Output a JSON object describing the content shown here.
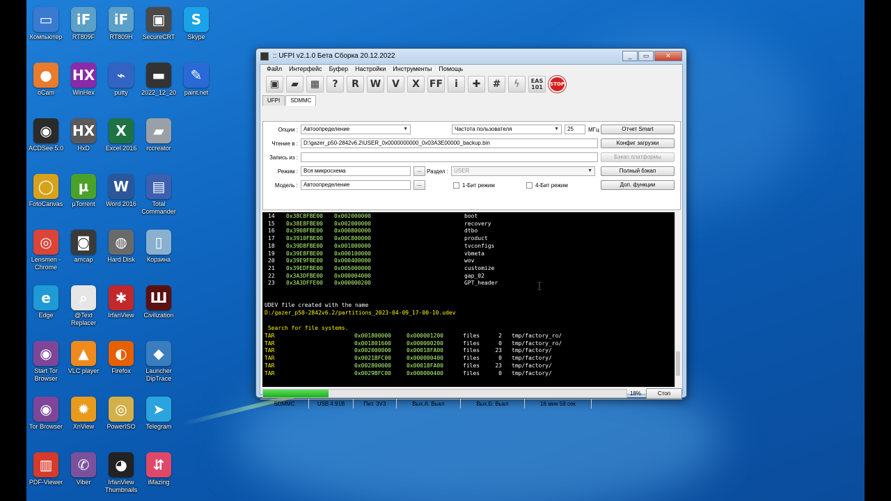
{
  "desktop": {
    "icons": [
      {
        "label": "Компьютер",
        "icon": "computer-icon",
        "glyph": "▭",
        "color": "#3a7ad0",
        "col": 0,
        "row": 0
      },
      {
        "label": "RT809F",
        "icon": "ifix-icon",
        "glyph": "iF",
        "color": "#5aa0c8",
        "col": 1,
        "row": 0
      },
      {
        "label": "RT809H",
        "icon": "ifix-icon",
        "glyph": "iF",
        "color": "#5aa0c8",
        "col": 2,
        "row": 0
      },
      {
        "label": "SecureCRT",
        "icon": "terminal-icon",
        "glyph": "▣",
        "color": "#4a4a4a",
        "col": 3,
        "row": 0
      },
      {
        "label": "Skype",
        "icon": "skype-icon",
        "glyph": "S",
        "color": "#1aa3e8",
        "col": 4,
        "row": 0
      },
      {
        "label": "oCam",
        "icon": "camera-icon",
        "glyph": "●",
        "color": "#e87b2c",
        "col": 0,
        "row": 1
      },
      {
        "label": "WinHex",
        "icon": "winhex-icon",
        "glyph": "HX",
        "color": "#8a2aa8",
        "col": 1,
        "row": 1
      },
      {
        "label": "putty",
        "icon": "putty-icon",
        "glyph": "⌁",
        "color": "#3364c4",
        "col": 2,
        "row": 1
      },
      {
        "label": "2022_12_20",
        "icon": "chip-icon",
        "glyph": "▬",
        "color": "#333333",
        "col": 3,
        "row": 1
      },
      {
        "label": "paint.net",
        "icon": "paint-icon",
        "glyph": "✎",
        "color": "#2a6ad6",
        "col": 4,
        "row": 1
      },
      {
        "label": "ACDSee 5.0",
        "icon": "eye-icon",
        "glyph": "◉",
        "color": "#2a2a2a",
        "col": 0,
        "row": 2
      },
      {
        "label": "HxD",
        "icon": "hxd-icon",
        "glyph": "HX",
        "color": "#5a5a5a",
        "col": 1,
        "row": 2
      },
      {
        "label": "Excel 2016",
        "icon": "excel-icon",
        "glyph": "X",
        "color": "#1f7244",
        "col": 2,
        "row": 2
      },
      {
        "label": "rccreator",
        "icon": "usb-icon",
        "glyph": "▰",
        "color": "#9aa0a8",
        "col": 3,
        "row": 2
      },
      {
        "label": "FotoCanvas",
        "icon": "fotocanvas-icon",
        "glyph": "◯",
        "color": "#d7a21a",
        "col": 0,
        "row": 3
      },
      {
        "label": "µTorrent",
        "icon": "utorrent-icon",
        "glyph": "µ",
        "color": "#4aa22a",
        "col": 1,
        "row": 3
      },
      {
        "label": "Word 2016",
        "icon": "word-icon",
        "glyph": "W",
        "color": "#2b579a",
        "col": 2,
        "row": 3
      },
      {
        "label": "Total Commander",
        "icon": "save-disk-icon",
        "glyph": "▤",
        "color": "#3c5fb0",
        "col": 3,
        "row": 3
      },
      {
        "label": "Lensmen - Chrome",
        "icon": "chrome-icon",
        "glyph": "◎",
        "color": "#db4437",
        "col": 0,
        "row": 4
      },
      {
        "label": "amcap",
        "icon": "camera-icon",
        "glyph": "◙",
        "color": "#3a3a3a",
        "col": 1,
        "row": 4
      },
      {
        "label": "Hard Disk",
        "icon": "harddisk-icon",
        "glyph": "◍",
        "color": "#6a6a6a",
        "col": 2,
        "row": 4
      },
      {
        "label": "Корзина",
        "icon": "trash-icon",
        "glyph": "▯",
        "color": "#8ab0d0",
        "col": 3,
        "row": 4
      },
      {
        "label": "Edge",
        "icon": "edge-icon",
        "glyph": "e",
        "color": "#1e9ad6",
        "col": 0,
        "row": 5
      },
      {
        "label": "@Text Replacer",
        "icon": "search-doc-icon",
        "glyph": "⌕",
        "color": "#e6e6e6",
        "col": 1,
        "row": 5
      },
      {
        "label": "IrfanView",
        "icon": "irfanview-icon",
        "glyph": "✱",
        "color": "#c0282a",
        "col": 2,
        "row": 5
      },
      {
        "label": "Civilization",
        "icon": "civilization-icon",
        "glyph": "Ш",
        "color": "#5a1010",
        "col": 3,
        "row": 5
      },
      {
        "label": "Start Tor Browser",
        "icon": "tor-icon",
        "glyph": "◉",
        "color": "#7d4698",
        "col": 0,
        "row": 6
      },
      {
        "label": "VLC player",
        "icon": "vlc-icon",
        "glyph": "▲",
        "color": "#f08a1c",
        "col": 1,
        "row": 6
      },
      {
        "label": "Firefox",
        "icon": "firefox-icon",
        "glyph": "◐",
        "color": "#e66000",
        "col": 2,
        "row": 6
      },
      {
        "label": "Launcher DipTrace",
        "icon": "diptrace-icon",
        "glyph": "◆",
        "color": "#3b7ec0",
        "col": 3,
        "row": 6
      },
      {
        "label": "Tor Browser",
        "icon": "tor-icon",
        "glyph": "◉",
        "color": "#7d4698",
        "col": 0,
        "row": 7
      },
      {
        "label": "XnView",
        "icon": "xnview-icon",
        "glyph": "✹",
        "color": "#e89a1c",
        "col": 1,
        "row": 7
      },
      {
        "label": "PowerISO",
        "icon": "disc-icon",
        "glyph": "◎",
        "color": "#d4b04a",
        "col": 2,
        "row": 7
      },
      {
        "label": "Telegram",
        "icon": "telegram-icon",
        "glyph": "➤",
        "color": "#2aa3de",
        "col": 3,
        "row": 7
      },
      {
        "label": "PDF-Viewer",
        "icon": "pdf-icon",
        "glyph": "▥",
        "color": "#d63a2a",
        "col": 0,
        "row": 8
      },
      {
        "label": "Viber",
        "icon": "viber-icon",
        "glyph": "✆",
        "color": "#7b519d",
        "col": 1,
        "row": 8
      },
      {
        "label": "IrfanView Thumbnails",
        "icon": "panda-icon",
        "glyph": "◕",
        "color": "#222222",
        "col": 2,
        "row": 8
      },
      {
        "label": "iMazing",
        "icon": "imazing-icon",
        "glyph": "⇵",
        "color": "#e0486a",
        "col": 3,
        "row": 8
      }
    ]
  },
  "window": {
    "title": ":: UFPI v2.1.0 Бета Сборка 20.12.2022",
    "minimize": "_",
    "maximize": "▭",
    "close": "✕",
    "menu": [
      "Файл",
      "Интерфейс",
      "Буфер",
      "Настройки",
      "Инструменты",
      "Помощь"
    ],
    "toolbar": [
      {
        "name": "save-icon",
        "glyph": "▣"
      },
      {
        "name": "open-folder-icon",
        "glyph": "▰"
      },
      {
        "name": "chip-icon",
        "glyph": "▦"
      },
      {
        "name": "identify-icon",
        "glyph": "?"
      },
      {
        "name": "read-icon",
        "glyph": "R"
      },
      {
        "name": "write-icon",
        "glyph": "W"
      },
      {
        "name": "verify-icon",
        "glyph": "V"
      },
      {
        "name": "erase-icon",
        "glyph": "X"
      },
      {
        "name": "blank-check-icon",
        "glyph": "FF"
      },
      {
        "name": "info-icon",
        "glyph": "i"
      },
      {
        "name": "plus-icon",
        "glyph": "✚"
      },
      {
        "name": "hash-icon",
        "glyph": "#"
      },
      {
        "name": "lightning-icon",
        "glyph": "ϟ"
      },
      {
        "name": "eas-icon",
        "glyph": "EAS 101"
      },
      {
        "name": "stop-icon",
        "glyph": "STOP"
      }
    ],
    "tabs": [
      "UFPI",
      "SDMMC"
    ],
    "active_tab": "SDMMC",
    "form": {
      "options_label": "Опции :",
      "options_value": "Автоопределение",
      "freq_value": "Частота пользователя",
      "freq_number": "25",
      "freq_unit": "МГц",
      "read_label": "Чтение в :",
      "read_value": "D:\\gazer_p50-2842v6.2\\USER_0x0000000000_0x03A3E00000_backup.bin",
      "write_label": "Запись из :",
      "write_value": "",
      "mode_label": "Режим :",
      "mode_value": "Вся микросхема",
      "mode_btn": "...",
      "partition_label": "Раздел :",
      "partition_value": "USER",
      "model_label": "Модель :",
      "model_value": "Автоопределение",
      "model_btn": "...",
      "bit1_label": "1-Бит режим",
      "bit4_label": "4-Бит режим",
      "btn_smart": "Отчет Smart",
      "btn_boot_config": "Конфиг загрузки",
      "btn_platform_backup": "Бэкап платформы",
      "btn_full_backup": "Полный бэкап",
      "btn_extra": "Доп. функции"
    },
    "console": {
      "partitions": [
        {
          "n": "14",
          "addr": "0x38C8FBE00",
          "size": "0x002000000",
          "name": "boot"
        },
        {
          "n": "15",
          "addr": "0x38E8FBE00",
          "size": "0x002000000",
          "name": "recovery"
        },
        {
          "n": "16",
          "addr": "0x3908FBE00",
          "size": "0x000800000",
          "name": "dtbo"
        },
        {
          "n": "17",
          "addr": "0x3910FBE00",
          "size": "0x00C800000",
          "name": "product"
        },
        {
          "n": "18",
          "addr": "0x39D8FBE00",
          "size": "0x001000000",
          "name": "tvconfigs"
        },
        {
          "n": "19",
          "addr": "0x39E8FBE00",
          "size": "0x000100000",
          "name": "vbmeta"
        },
        {
          "n": "20",
          "addr": "0x39E9FBE00",
          "size": "0x000400000",
          "name": "wov"
        },
        {
          "n": "21",
          "addr": "0x39EDFBE00",
          "size": "0x005000000",
          "name": "customize"
        },
        {
          "n": "22",
          "addr": "0x3A3DFBE00",
          "size": "0x000004000",
          "name": "gap_02"
        },
        {
          "n": "23",
          "addr": "0x3A3DFFE00",
          "size": "0x000000200",
          "name": "GPT_header"
        }
      ],
      "udev_msg": "UDEV file created with the name",
      "udev_path": "D:/gazer_p50-2842v6.2/partitions_2023-04-09_17-00-10.udev",
      "fs_msg": " Search for file systems.",
      "fs_rows": [
        {
          "type": "TAR",
          "addr": "0x001800000",
          "size": "0x000001200",
          "kind": "files",
          "count": "2",
          "path": "tmp/factory_ro/"
        },
        {
          "type": "TAR",
          "addr": "0x001801600",
          "size": "0x000000200",
          "kind": "files",
          "count": "0",
          "path": "tmp/factory_ro/"
        },
        {
          "type": "TAR",
          "addr": "0x002000000",
          "size": "0x00018FA00",
          "kind": "files",
          "count": "23",
          "path": "tmp/factory/"
        },
        {
          "type": "TAR",
          "addr": "0x0021BFC00",
          "size": "0x000000400",
          "kind": "files",
          "count": "0",
          "path": "tmp/factory/"
        },
        {
          "type": "TAR",
          "addr": "0x002800000",
          "size": "0x00018FA00",
          "kind": "files",
          "count": "23",
          "path": "tmp/factory/"
        },
        {
          "type": "TAR",
          "addr": "0x0029BFC00",
          "size": "0x000000400",
          "kind": "files",
          "count": "0",
          "path": "tmp/factory/"
        }
      ]
    },
    "progress": {
      "value": 0.18,
      "label": "18%",
      "stop": "Стоп"
    },
    "status": [
      "SDMMC",
      "USB 4.91B",
      "Пит. 3V3",
      "Вых.А: Выкл",
      "Вых.Б: Выкл",
      "16 мин 59 сек"
    ]
  }
}
